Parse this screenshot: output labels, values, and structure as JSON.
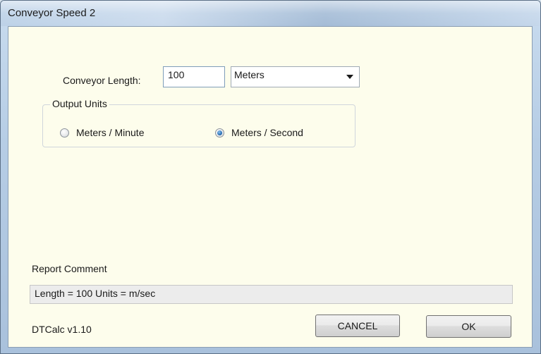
{
  "window": {
    "title": "Conveyor Speed 2"
  },
  "form": {
    "length_label": "Conveyor Length:",
    "length_value": "100",
    "units_selected": "Meters"
  },
  "output_units": {
    "legend": "Output Units",
    "options": [
      {
        "label": "Meters / Minute",
        "checked": false
      },
      {
        "label": "Meters / Second",
        "checked": true
      }
    ]
  },
  "report": {
    "label": "Report Comment",
    "value": "Length = 100  Units = m/sec"
  },
  "footer": {
    "version": "DTCalc v1.10",
    "cancel_label": "CANCEL",
    "ok_label": "OK"
  }
}
